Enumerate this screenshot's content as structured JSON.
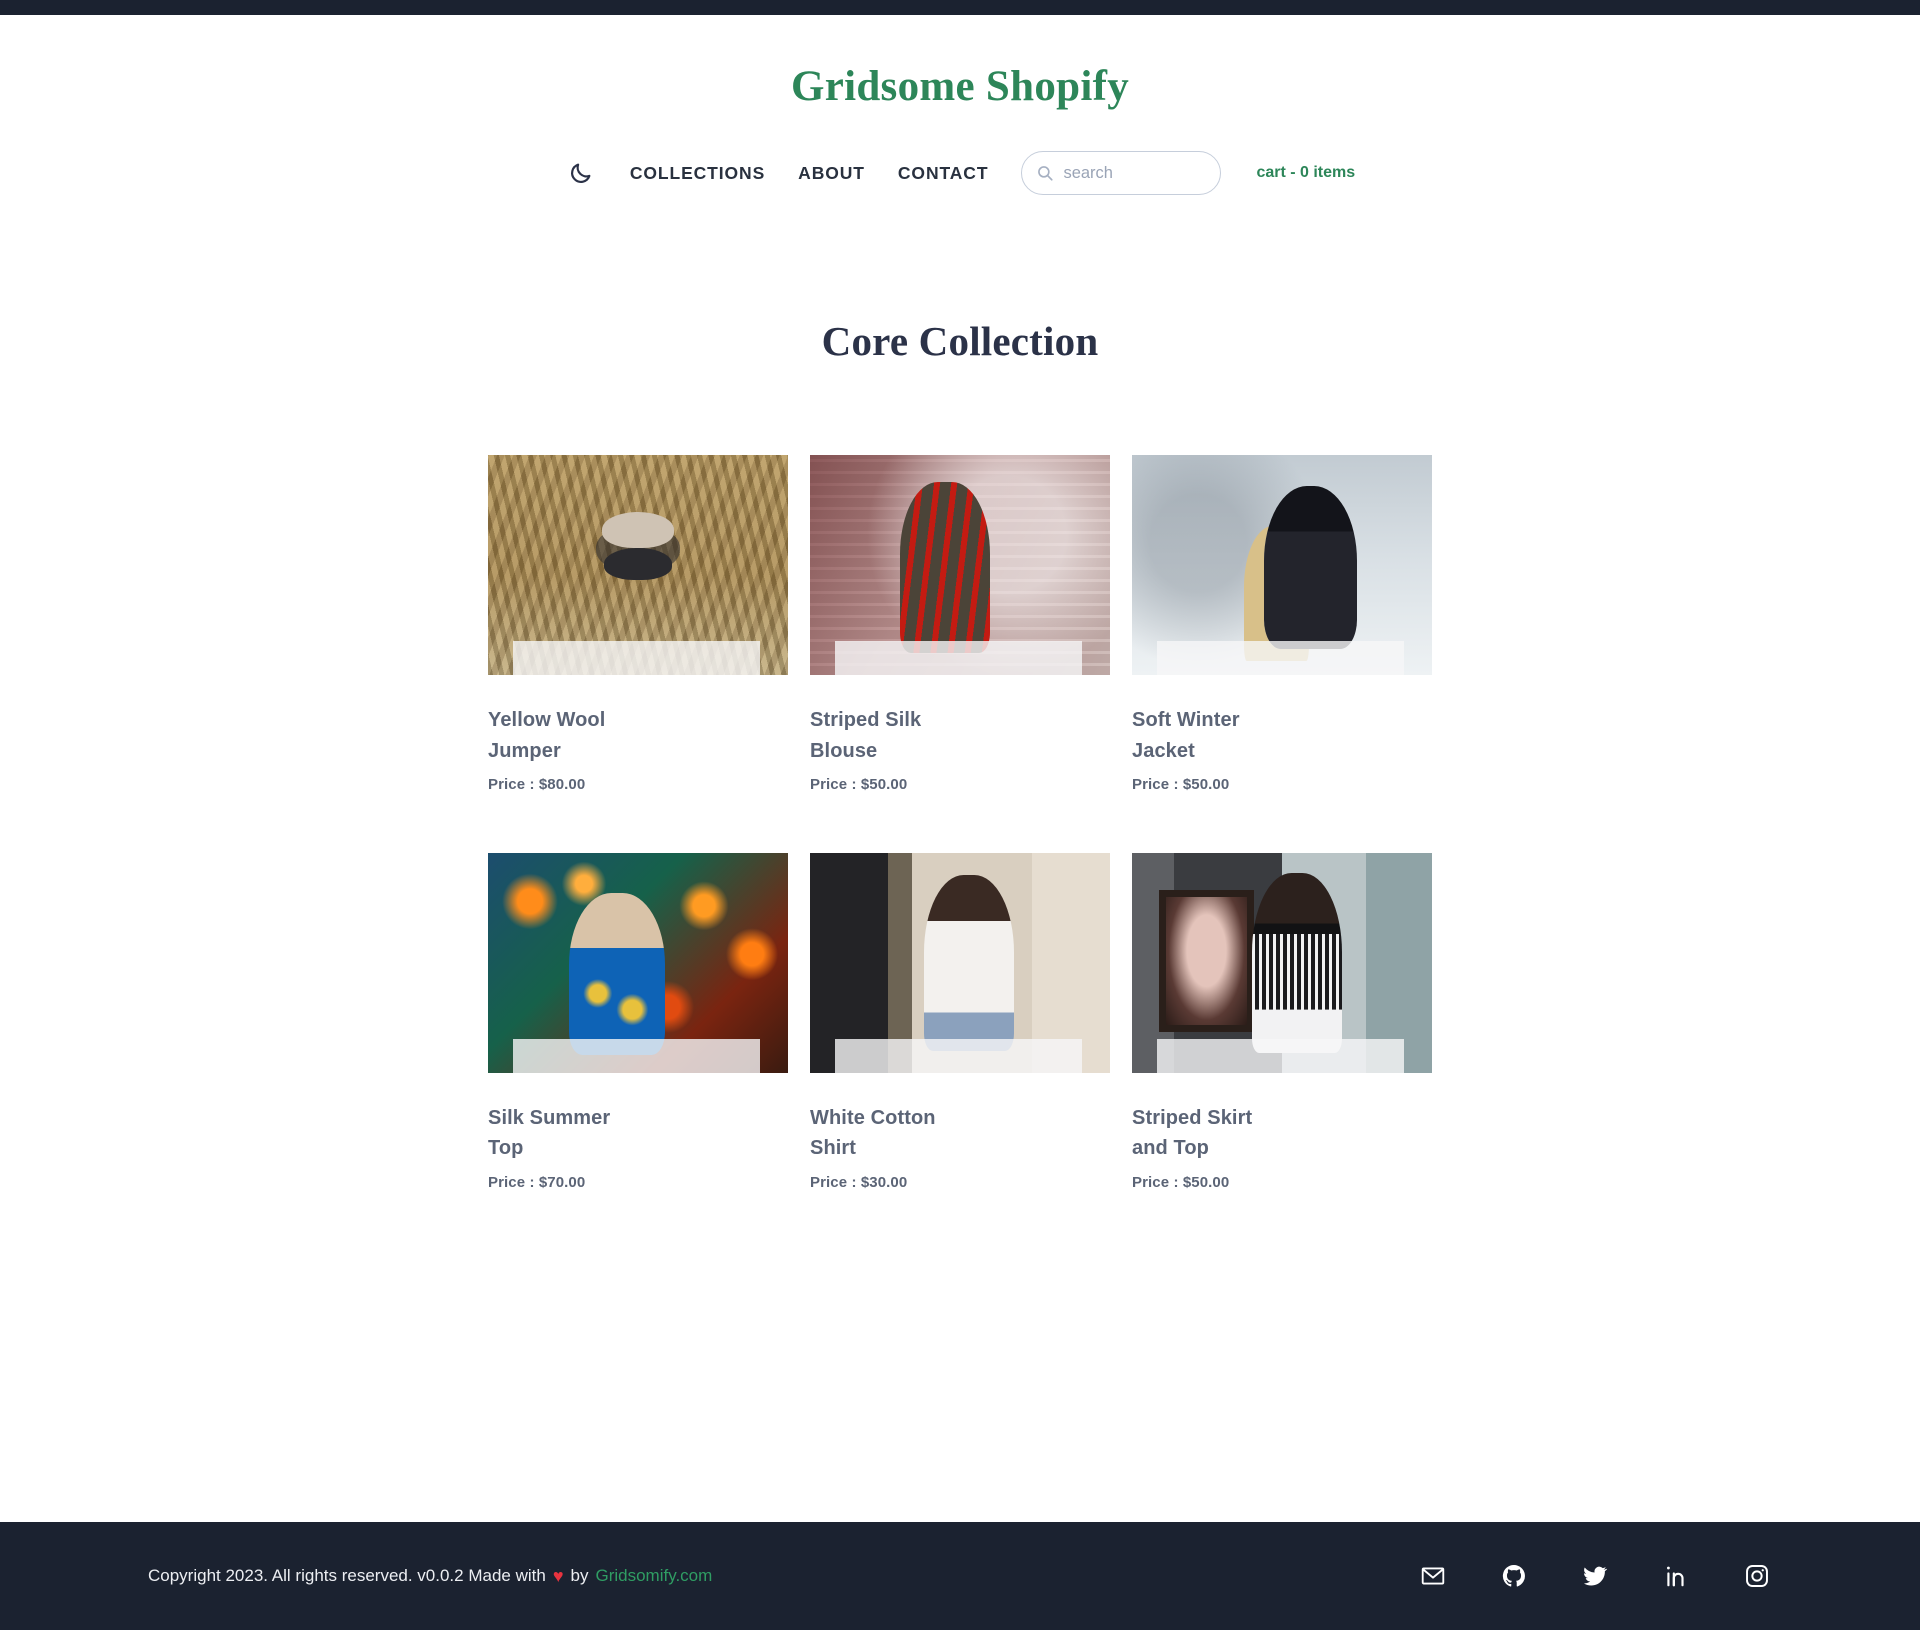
{
  "site": {
    "title": "Gridsome Shopify"
  },
  "nav": {
    "theme_toggle_icon": "moon-icon",
    "links": [
      {
        "label": "COLLECTIONS"
      },
      {
        "label": "ABOUT"
      },
      {
        "label": "CONTACT"
      }
    ],
    "search": {
      "icon": "search-icon",
      "placeholder": "search",
      "value": ""
    },
    "cart_label": "cart - 0 items"
  },
  "main": {
    "collection_title": "Core Collection",
    "price_prefix": "Price : ",
    "products": [
      {
        "title": "Yellow Wool Jumper",
        "price": "$80.00",
        "price_line": "Price : $80.00",
        "image_alt": "woman holding camera in a corn field",
        "image_style": "ph-corn"
      },
      {
        "title": "Striped Silk Blouse",
        "price": "$50.00",
        "price_line": "Price : $50.00",
        "image_alt": "woman in red striped silk blouse against brick wall",
        "image_style": "ph-red"
      },
      {
        "title": "Soft Winter Jacket",
        "price": "$50.00",
        "price_line": "Price : $50.00",
        "image_alt": "blonde woman in black winter jacket and cap in snow",
        "image_style": "ph-snow"
      },
      {
        "title": "Silk Summer Top",
        "price": "$70.00",
        "price_line": "Price : $70.00",
        "image_alt": "woman with sunglasses in front of carnival lights",
        "image_style": "ph-carnival"
      },
      {
        "title": "White Cotton Shirt",
        "price": "$30.00",
        "price_line": "Price : $30.00",
        "image_alt": "smiling woman in white cotton shirt on street",
        "image_style": "ph-street"
      },
      {
        "title": "Striped Skirt and Top",
        "price": "$50.00",
        "price_line": "Price : $50.00",
        "image_alt": "woman in black top and striped skirt near gallery painting",
        "image_style": "ph-gallery"
      }
    ]
  },
  "footer": {
    "copyright_text": "Copyright 2023. All rights reserved. v0.0.2 Made with",
    "heart": "♥",
    "by_text": "by",
    "made_by_link": "Gridsomify.com",
    "socials": [
      {
        "name": "email-icon"
      },
      {
        "name": "github-icon"
      },
      {
        "name": "twitter-icon"
      },
      {
        "name": "linkedin-icon"
      },
      {
        "name": "instagram-icon"
      }
    ]
  },
  "colors": {
    "brand_green": "#2d8659",
    "dark_navy": "#1b2230",
    "heading": "#2b3248",
    "body_text": "#5b6476",
    "heart_red": "#e8333f"
  }
}
